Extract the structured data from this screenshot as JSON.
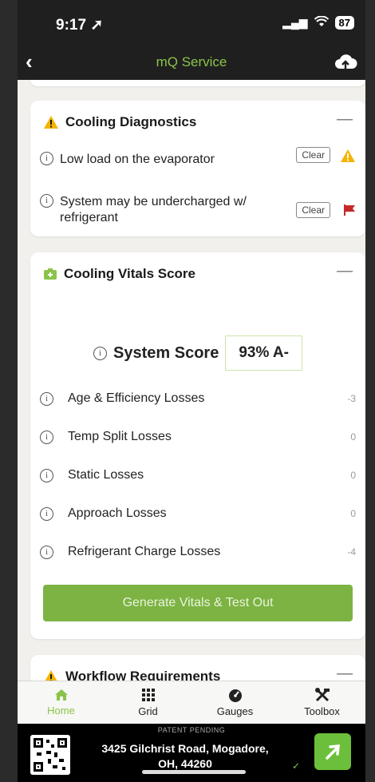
{
  "status": {
    "time": "9:17",
    "battery": "87"
  },
  "nav": {
    "title": "mQ Service",
    "back_icon": "chevron-left-icon",
    "upload_icon": "cloud-upload-icon"
  },
  "diagnostics": {
    "title": "Cooling Diagnostics",
    "collapse": "—",
    "items": [
      {
        "text": "Low load on the evaporator",
        "action": "Clear",
        "severity": "warning"
      },
      {
        "text": "System may be undercharged w/ refrigerant",
        "action": "Clear",
        "severity": "flag"
      }
    ]
  },
  "vitals": {
    "title": "Cooling Vitals Score",
    "collapse": "—",
    "score_label": "System Score",
    "score_value": "93% A-",
    "losses": [
      {
        "label": "Age & Efficiency Losses",
        "value": "-3"
      },
      {
        "label": "Temp Split Losses",
        "value": "0"
      },
      {
        "label": "Static Losses",
        "value": "0"
      },
      {
        "label": "Approach Losses",
        "value": "0"
      },
      {
        "label": "Refrigerant Charge Losses",
        "value": "-4"
      }
    ],
    "button": "Generate Vitals & Test Out"
  },
  "workflow": {
    "title": "Workflow Requirements",
    "collapse": "—"
  },
  "tabs": [
    {
      "label": "Home",
      "icon": "home-icon",
      "active": true
    },
    {
      "label": "Grid",
      "icon": "grid-icon",
      "active": false
    },
    {
      "label": "Gauges",
      "icon": "gauge-icon",
      "active": false
    },
    {
      "label": "Toolbox",
      "icon": "tools-icon",
      "active": false
    }
  ],
  "footer": {
    "patent": "PATENT PENDING",
    "address_line1": "3425 Gilchrist Road, Mogadore,",
    "address_line2": "OH, 44260"
  },
  "colors": {
    "accent": "#8bc34a",
    "button": "#7cb342",
    "warning": "#f4b400",
    "flag": "#c62828",
    "header": "#1f1f1f"
  }
}
